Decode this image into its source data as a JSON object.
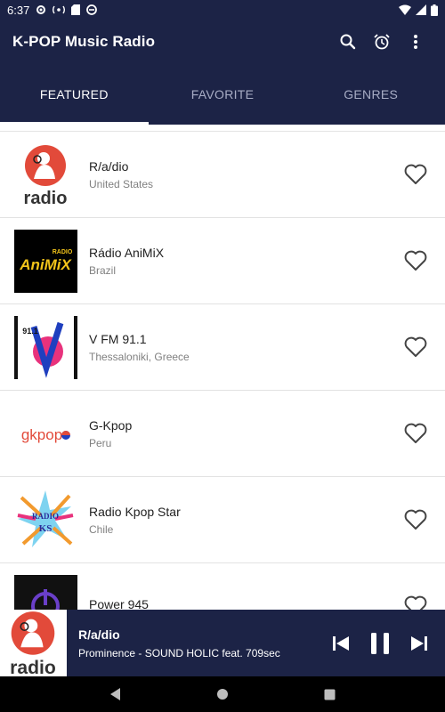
{
  "status_bar": {
    "time": "6:37",
    "icons": [
      "settings-gear-icon",
      "wireless-icon",
      "sd-card-icon",
      "sync-icon",
      "wifi-icon",
      "signal-icon",
      "battery-icon"
    ]
  },
  "app_bar": {
    "title": "K-POP Music Radio",
    "actions": [
      "search-icon",
      "alarm-icon",
      "more-vert-icon"
    ]
  },
  "tabs": [
    {
      "label": "FEATURED",
      "active": true
    },
    {
      "label": "FAVORITE",
      "active": false
    },
    {
      "label": "GENRES",
      "active": false
    }
  ],
  "stations": [
    {
      "name": "R/a/dio",
      "location": "United States",
      "logo": "radio-girl-logo",
      "logo_text": "radio"
    },
    {
      "name": "Rádio AniMiX",
      "location": "Brazil",
      "logo": "animix-logo",
      "logo_text": "AniMiX",
      "logo_small_text": "RADIO"
    },
    {
      "name": "V FM 91.1",
      "location": "Thessaloniki, Greece",
      "logo": "vfm-logo",
      "logo_text": "91.1"
    },
    {
      "name": "G-Kpop",
      "location": "Peru",
      "logo": "gkpop-logo",
      "logo_text": "gkpop"
    },
    {
      "name": "Radio Kpop Star",
      "location": "Chile",
      "logo": "kpop-star-logo",
      "logo_text": "RADIO",
      "logo_small_text": "KS"
    },
    {
      "name": "Power 945",
      "location": "",
      "logo": "power-logo"
    }
  ],
  "player": {
    "station": "R/a/dio",
    "track": "Prominence - SOUND HOLIC feat. 709sec",
    "controls": [
      "skip-previous-icon",
      "pause-icon",
      "skip-next-icon"
    ]
  },
  "nav_bar": [
    "back-icon",
    "home-icon",
    "recents-icon"
  ],
  "colors": {
    "primary": "#1c2346",
    "accent_red": "#e24a3a",
    "text_primary": "#222222",
    "text_secondary": "#808080"
  }
}
